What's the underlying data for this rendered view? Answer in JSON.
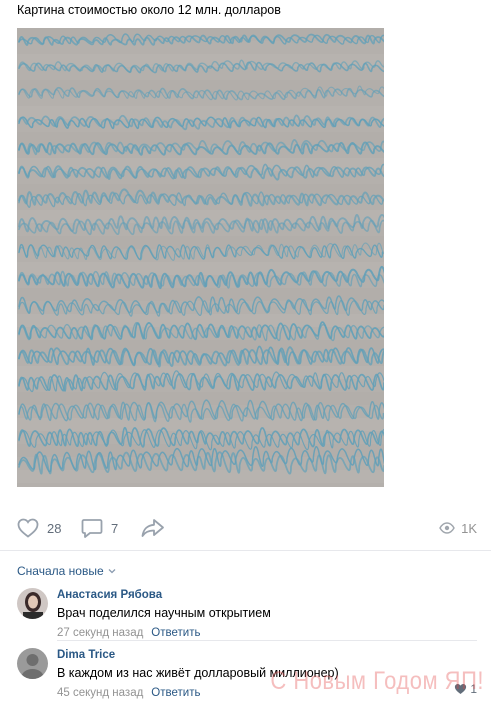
{
  "post": {
    "text": "Картина стоимостью около 12 млн. долларов"
  },
  "actions": {
    "likes": "28",
    "comments": "7",
    "views": "1K",
    "icons": [
      "heart-icon",
      "comment-icon",
      "share-icon",
      "eye-icon"
    ]
  },
  "comments_section": {
    "sort_label": "Сначала новые"
  },
  "comments": [
    {
      "author": "Анастасия Рябова",
      "text": "Врач поделился научным открытием",
      "time": "27 секунд назад",
      "reply": "Ответить"
    },
    {
      "author": "Dima Trice",
      "text": "В каждом из нас живёт долларовый миллионер)",
      "time": "45 секунд назад",
      "reply": "Ответить",
      "likes": "1"
    }
  ],
  "watermark": "С Новым Годом ЯП!",
  "colors": {
    "link": "#2a5885",
    "meta": "#939393",
    "painting_bg": "#b4b0ac",
    "scribble": "#5f9fb8"
  }
}
